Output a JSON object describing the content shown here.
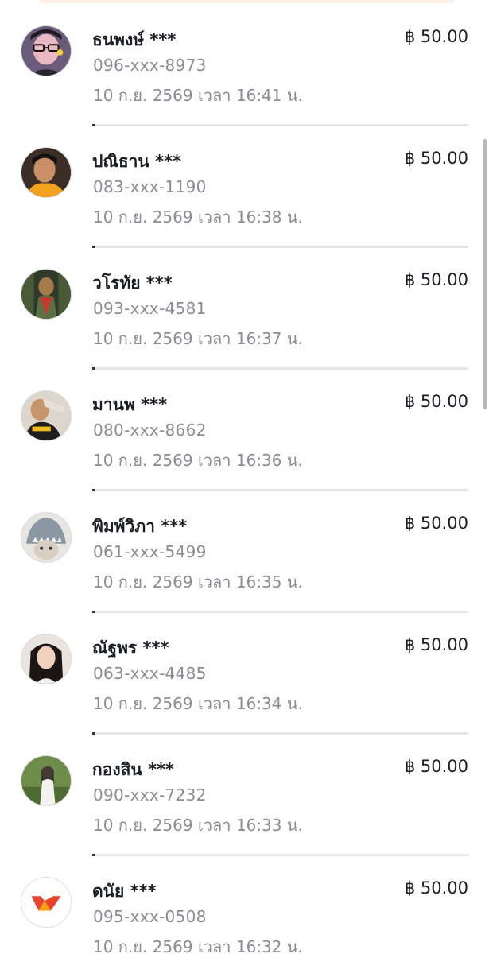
{
  "transactions": [
    {
      "name": "ธนพงษ์ ***",
      "phone": "096-xxx-8973",
      "time": "10 ก.ย. 2569 เวลา 16:41 น.",
      "amount": "฿ 50.00",
      "avatar": "selfie-avatar"
    },
    {
      "name": "ปณิธาน ***",
      "phone": "083-xxx-1190",
      "time": "10 ก.ย. 2569 เวลา 16:38 น.",
      "amount": "฿ 50.00",
      "avatar": "selfie-avatar"
    },
    {
      "name": "วโรทัย ***",
      "phone": "093-xxx-4581",
      "time": "10 ก.ย. 2569 เวลา 16:37 น.",
      "amount": "฿ 50.00",
      "avatar": "character-avatar"
    },
    {
      "name": "มานพ ***",
      "phone": "080-xxx-8662",
      "time": "10 ก.ย. 2569 เวลา 16:36 น.",
      "amount": "฿ 50.00",
      "avatar": "selfie-avatar"
    },
    {
      "name": "พิมพ์วิภา ***",
      "phone": "061-xxx-5499",
      "time": "10 ก.ย. 2569 เวลา 16:35 น.",
      "amount": "฿ 50.00",
      "avatar": "shark-cat-avatar"
    },
    {
      "name": "ณัฐพร ***",
      "phone": "063-xxx-4485",
      "time": "10 ก.ย. 2569 เวลา 16:34 น.",
      "amount": "฿ 50.00",
      "avatar": "portrait-avatar"
    },
    {
      "name": "กองสิน ***",
      "phone": "090-xxx-7232",
      "time": "10 ก.ย. 2569 เวลา 16:33 น.",
      "amount": "฿ 50.00",
      "avatar": "outdoor-portrait-avatar"
    },
    {
      "name": "ดนัย ***",
      "phone": "095-xxx-0508",
      "time": "10 ก.ย. 2569 เวลา 16:32 น.",
      "amount": "฿ 50.00",
      "avatar": "wallet-logo-avatar"
    }
  ],
  "colors": {
    "text_primary": "#1d1d25",
    "text_secondary": "#8c8c94",
    "divider": "#e6e6e6",
    "logo_red": "#e8452c",
    "logo_orange": "#f6a01a"
  }
}
